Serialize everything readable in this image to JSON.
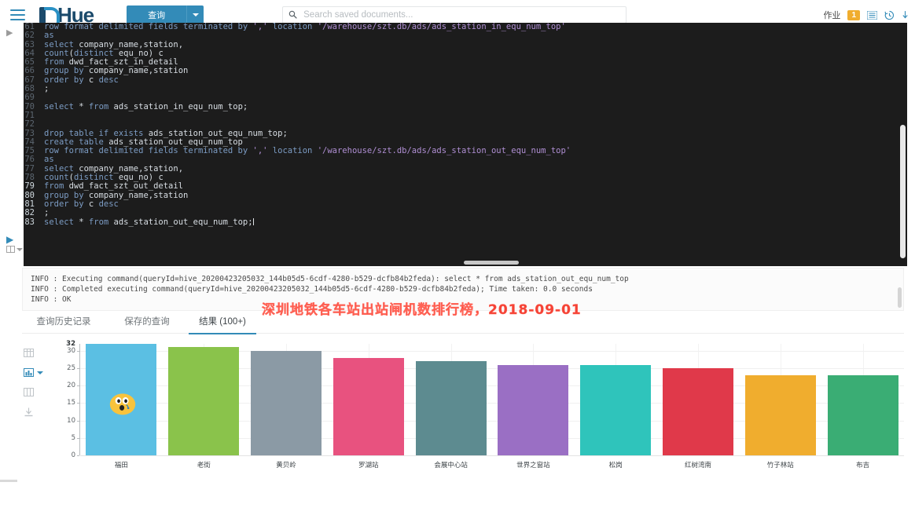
{
  "header": {
    "hamburger_icon": "hamburger-menu-icon",
    "brand": "Hue",
    "query_button": "查询",
    "query_caret_icon": "chevron-down-icon",
    "search": {
      "placeholder": "Search saved documents...",
      "value": "",
      "icon": "search-icon"
    },
    "jobs_label": "作业",
    "jobs_badge": "1",
    "jobs_list_icon": "list-icon",
    "history_icon": "history-icon",
    "download_icon": "download-icon"
  },
  "editor": {
    "expand_icon": "expand-arrow-icon",
    "run_icon": "run-play-icon",
    "book_icon": "book-icon",
    "book_caret_icon": "chevron-down-icon",
    "lines": [
      {
        "n": "61",
        "hl": false,
        "tokens": [
          {
            "t": "row format delimited fields terminated by ",
            "c": "kw"
          },
          {
            "t": "','",
            "c": "str"
          },
          {
            "t": " location ",
            "c": "kw"
          },
          {
            "t": "'/warehouse/szt.db/ads/ads_station_in_equ_num_top'",
            "c": "str"
          }
        ]
      },
      {
        "n": "62",
        "hl": false,
        "tokens": [
          {
            "t": "as",
            "c": "kw"
          }
        ]
      },
      {
        "n": "63",
        "hl": false,
        "tokens": [
          {
            "t": "select ",
            "c": "kw"
          },
          {
            "t": "company_name,station,",
            "c": "id"
          }
        ]
      },
      {
        "n": "64",
        "hl": false,
        "tokens": [
          {
            "t": "count",
            "c": "fn"
          },
          {
            "t": "(",
            "c": "pl"
          },
          {
            "t": "distinct ",
            "c": "kw"
          },
          {
            "t": "equ_no",
            "c": "id"
          },
          {
            "t": ") ",
            "c": "pl"
          },
          {
            "t": "c",
            "c": "id"
          }
        ]
      },
      {
        "n": "65",
        "hl": false,
        "tokens": [
          {
            "t": "from ",
            "c": "kw"
          },
          {
            "t": "dwd_fact_szt_in_detail",
            "c": "id"
          }
        ]
      },
      {
        "n": "66",
        "hl": false,
        "tokens": [
          {
            "t": "group by ",
            "c": "kw"
          },
          {
            "t": "company_name,station",
            "c": "id"
          }
        ]
      },
      {
        "n": "67",
        "hl": false,
        "tokens": [
          {
            "t": "order by ",
            "c": "kw"
          },
          {
            "t": "c ",
            "c": "id"
          },
          {
            "t": "desc",
            "c": "kw"
          }
        ]
      },
      {
        "n": "68",
        "hl": false,
        "tokens": [
          {
            "t": ";",
            "c": "pl"
          }
        ]
      },
      {
        "n": "69",
        "hl": false,
        "tokens": [
          {
            "t": "",
            "c": "pl"
          }
        ]
      },
      {
        "n": "70",
        "hl": false,
        "tokens": [
          {
            "t": "select ",
            "c": "kw"
          },
          {
            "t": "* ",
            "c": "pl"
          },
          {
            "t": "from ",
            "c": "kw"
          },
          {
            "t": "ads_station_in_equ_num_top;",
            "c": "id"
          }
        ]
      },
      {
        "n": "71",
        "hl": false,
        "tokens": [
          {
            "t": "",
            "c": "pl"
          }
        ]
      },
      {
        "n": "72",
        "hl": false,
        "tokens": [
          {
            "t": "",
            "c": "pl"
          }
        ]
      },
      {
        "n": "73",
        "hl": false,
        "tokens": [
          {
            "t": "drop table if exists ",
            "c": "kw"
          },
          {
            "t": "ads_station_out_equ_num_top;",
            "c": "id"
          }
        ]
      },
      {
        "n": "74",
        "hl": false,
        "tokens": [
          {
            "t": "create table ",
            "c": "kw"
          },
          {
            "t": "ads_station_out_equ_num_top",
            "c": "id"
          }
        ]
      },
      {
        "n": "75",
        "hl": false,
        "tokens": [
          {
            "t": "row format delimited fields terminated by ",
            "c": "kw"
          },
          {
            "t": "','",
            "c": "str"
          },
          {
            "t": " location ",
            "c": "kw"
          },
          {
            "t": "'/warehouse/szt.db/ads/ads_station_out_equ_num_top'",
            "c": "str"
          }
        ]
      },
      {
        "n": "76",
        "hl": false,
        "tokens": [
          {
            "t": "as",
            "c": "kw"
          }
        ]
      },
      {
        "n": "77",
        "hl": false,
        "tokens": [
          {
            "t": "select ",
            "c": "kw"
          },
          {
            "t": "company_name,station,",
            "c": "id"
          }
        ]
      },
      {
        "n": "78",
        "hl": false,
        "tokens": [
          {
            "t": "count",
            "c": "fn"
          },
          {
            "t": "(",
            "c": "pl"
          },
          {
            "t": "distinct ",
            "c": "kw"
          },
          {
            "t": "equ_no",
            "c": "id"
          },
          {
            "t": ") ",
            "c": "pl"
          },
          {
            "t": "c",
            "c": "id"
          }
        ]
      },
      {
        "n": "79",
        "hl": true,
        "tokens": [
          {
            "t": "from ",
            "c": "kw"
          },
          {
            "t": "dwd_fact_szt_out_detail",
            "c": "id"
          }
        ]
      },
      {
        "n": "80",
        "hl": true,
        "tokens": [
          {
            "t": "group by ",
            "c": "kw"
          },
          {
            "t": "company_name,station",
            "c": "id"
          }
        ]
      },
      {
        "n": "81",
        "hl": true,
        "tokens": [
          {
            "t": "order by ",
            "c": "kw"
          },
          {
            "t": "c ",
            "c": "id"
          },
          {
            "t": "desc",
            "c": "kw"
          }
        ]
      },
      {
        "n": "82",
        "hl": true,
        "tokens": [
          {
            "t": ";",
            "c": "pl"
          }
        ]
      },
      {
        "n": "83",
        "hl": true,
        "cursor": true,
        "tokens": [
          {
            "t": "select ",
            "c": "kw"
          },
          {
            "t": "* ",
            "c": "pl"
          },
          {
            "t": "from ",
            "c": "kw"
          },
          {
            "t": "ads_station_out_equ_num_top;",
            "c": "id"
          }
        ]
      }
    ]
  },
  "log": {
    "lines": [
      "INFO  : Executing command(queryId=hive_20200423205032_144b05d5-6cdf-4280-b529-dcfb84b2feda): select * from ads_station_out_equ_num_top",
      "INFO  : Completed executing command(queryId=hive_20200423205032_144b05d5-6cdf-4280-b529-dcfb84b2feda); Time taken: 0.0 seconds",
      "INFO  : OK"
    ]
  },
  "annotation": {
    "title": "深圳地铁各车站出站闸机数排行榜，2018-09-01"
  },
  "tabs": [
    {
      "label": "查询历史记录",
      "active": false
    },
    {
      "label": "保存的查询",
      "active": false
    },
    {
      "label": "结果 (100+)",
      "active": true
    }
  ],
  "result_rail": [
    {
      "icon": "grid-table-icon",
      "active": false
    },
    {
      "icon": "bar-chart-icon",
      "active": true,
      "caret": "chevron-down-icon"
    },
    {
      "icon": "columns-icon",
      "active": false
    },
    {
      "icon": "download-icon",
      "active": false
    }
  ],
  "chart_data": {
    "type": "bar",
    "title": "深圳地铁各车站出站闸机数排行榜，2018-09-01",
    "xlabel": "",
    "ylabel": "",
    "ylim": [
      0,
      32
    ],
    "yticks": [
      0,
      5,
      10,
      15,
      20,
      25,
      30
    ],
    "ymax_label": "32",
    "grid": true,
    "legend": "none",
    "categories": [
      "福田",
      "老街",
      "黄贝岭",
      "罗湖站",
      "会展中心站",
      "世界之窗站",
      "松岗",
      "红树湾南",
      "竹子林站",
      "布吉"
    ],
    "values": [
      32,
      31,
      30,
      28,
      27,
      26,
      26,
      25,
      23,
      23
    ],
    "colors": [
      "#5bbfe3",
      "#8ac34b",
      "#8b9aa5",
      "#e8527f",
      "#5d8b90",
      "#9a6fc4",
      "#2fc4bb",
      "#e0394a",
      "#f0ad2e",
      "#3aad74"
    ]
  },
  "emoji": {
    "icon": "cursor-emoji-overlay"
  }
}
